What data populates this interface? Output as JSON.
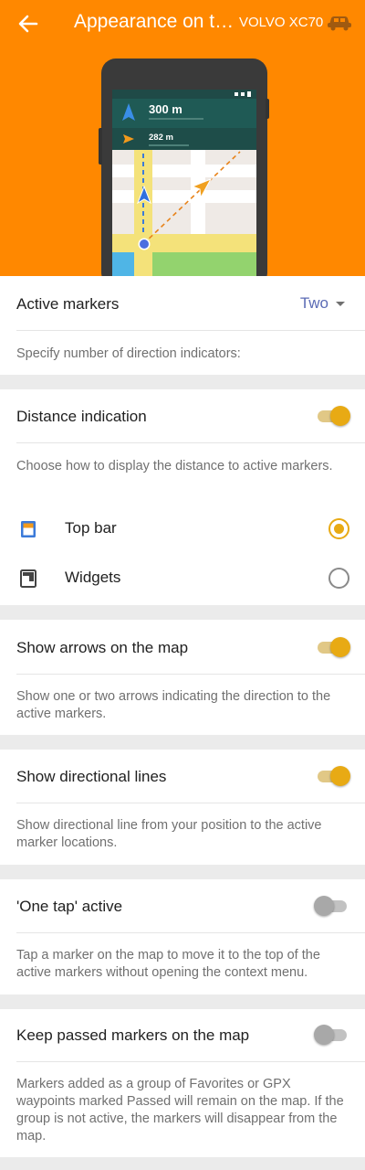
{
  "appbar": {
    "title": "Appearance on t…",
    "vehicle": "VOLVO XC70",
    "back_icon": "arrow-left-icon",
    "vehicle_icon": "car-icon"
  },
  "preview": {
    "distance_1": "300 m",
    "distance_2": "282 m"
  },
  "active_markers": {
    "label": "Active markers",
    "value": "Two",
    "description": "Specify number of direction indicators:"
  },
  "distance_indication": {
    "label": "Distance indication",
    "enabled": true,
    "description": "Choose how to display the distance to active markers.",
    "options": [
      {
        "label": "Top bar",
        "icon": "top-bar-icon",
        "selected": true
      },
      {
        "label": "Widgets",
        "icon": "widgets-icon",
        "selected": false
      }
    ]
  },
  "show_arrows": {
    "label": "Show arrows on the map",
    "enabled": true,
    "description": "Show one or two arrows indicating the direction to the active markers."
  },
  "directional_lines": {
    "label": "Show directional lines",
    "enabled": true,
    "description": "Show directional line from your position to the active marker locations."
  },
  "one_tap": {
    "label": "'One tap' active",
    "enabled": false,
    "description": "Tap a marker on the map to move it to the top of the active markers without opening the context menu."
  },
  "keep_passed": {
    "label": "Keep passed markers on the map",
    "enabled": false,
    "description": "Markers added as a group of Favorites or GPX waypoints marked Passed will remain on the map. If the group is not active, the markers will disappear from the map."
  },
  "colors": {
    "header": "#ff8800",
    "accent": "#e8aa14",
    "dropdown_value": "#5b6bb5"
  }
}
